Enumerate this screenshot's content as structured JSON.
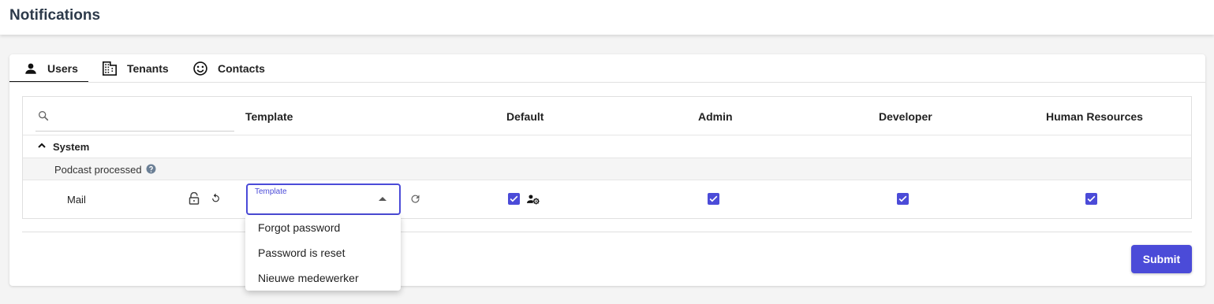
{
  "page": {
    "title": "Notifications"
  },
  "tabs": [
    {
      "label": "Users",
      "icon": "person-icon",
      "active": true
    },
    {
      "label": "Tenants",
      "icon": "building-icon",
      "active": false
    },
    {
      "label": "Contacts",
      "icon": "smiley-icon",
      "active": false
    }
  ],
  "table": {
    "search": {
      "placeholder": "",
      "value": ""
    },
    "columns": [
      "Template",
      "Default",
      "Admin",
      "Developer",
      "Human Resources"
    ],
    "group": {
      "label": "System",
      "expanded": true
    },
    "event": {
      "label": "Podcast processed"
    },
    "channel": {
      "label": "Mail",
      "template_select_label": "Template",
      "template_value": "",
      "checks": {
        "default": true,
        "admin": true,
        "developer": true,
        "human_resources": true
      }
    }
  },
  "dropdown": {
    "options": [
      "Forgot password",
      "Password is reset",
      "Nieuwe medewerker"
    ]
  },
  "actions": {
    "submit_label": "Submit"
  },
  "colors": {
    "accent": "#4b4bd8",
    "title": "#2d3a4a"
  }
}
